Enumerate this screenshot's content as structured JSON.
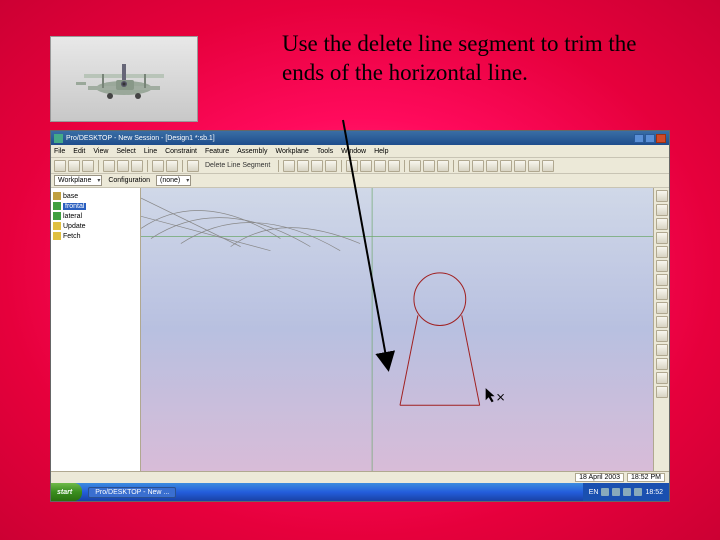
{
  "instruction_text": "Use the delete line segment to trim the ends of the  horizontal line.",
  "app": {
    "title": "Pro/DESKTOP - New Session - [Design1 *:sb.1]",
    "menus": [
      "File",
      "Edit",
      "View",
      "Select",
      "Line",
      "Constraint",
      "Feature",
      "Assembly",
      "Workplane",
      "Tools",
      "Window",
      "Help"
    ],
    "tool_label": "Delete Line Segment",
    "subbar": {
      "left_label": "Workplane",
      "config_label": "Configuration",
      "config_value": "(none)"
    },
    "tree": [
      {
        "icon": "cube",
        "label": "base"
      },
      {
        "icon": "green",
        "label": "frontal",
        "highlight": true
      },
      {
        "icon": "green",
        "label": "lateral"
      },
      {
        "icon": "y",
        "label": "Update"
      },
      {
        "icon": "y",
        "label": "Fetch"
      }
    ],
    "status": {
      "date": "18 April 2003",
      "time": "18:52 PM"
    }
  },
  "taskbar": {
    "start": "start",
    "task": "Pro/DESKTOP - New ...",
    "lang": "EN",
    "clock": "18:52"
  }
}
